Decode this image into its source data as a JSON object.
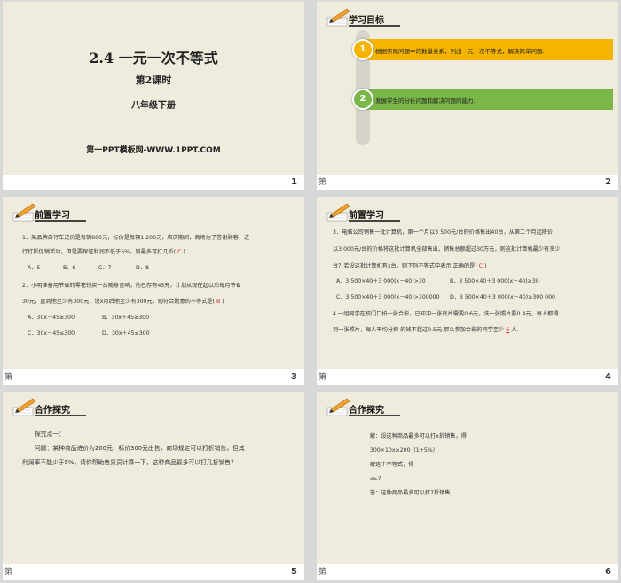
{
  "slide1": {
    "title": "2.4  一元一次不等式",
    "subtitle": "第2课时",
    "grade": "八年级下册",
    "site": "第一PPT模板网-WWW.1PPT.COM",
    "number": "1"
  },
  "slide2": {
    "header": "学习目标",
    "goals": [
      {
        "num": "1",
        "text": "根据实际问题中的数量关系，列出一元一次不等式，解决简单问题.",
        "color": "#f4b400"
      },
      {
        "num": "2",
        "text": "发展学生的分析问题和解决问题的能力.",
        "color": "#7ab648"
      }
    ],
    "number": "2",
    "note": "第"
  },
  "slide3": {
    "header": "前置学习",
    "q1_line1": "1．某品牌自行车进价是每辆800元，标价是每辆1 200元，店庆期间，商场为了答谢顾客，进",
    "q1_line2_a": "行打折促销活动，但是要保证利润不低于5%，则最多可打几折(",
    "q1_answer": "C",
    "q1_line2_b": ")",
    "q1_options": [
      "A．5",
      "B．6",
      "C．7",
      "D．8"
    ],
    "q2_line1": "2．小明准备用节省的零花钱买一台随身音响，他已存有45元，计划从现在起以后每月节省",
    "q2_line2_a": "30元，直到他至少有300元．设x月后他至少有300元，则符合题意的不等式是(",
    "q2_answer": "B",
    "q2_line2_b": ")",
    "q2_options": [
      "A．30x－45≥300",
      "B．30x＋45≥300",
      "C．30x－45≤300",
      "D．30x＋45≤300"
    ],
    "number": "3",
    "note": "第"
  },
  "slide4": {
    "header": "前置学习",
    "q3_line1": "3．电脑公司销售一批计算机，第一个月以3 500元/台的价格售出40台，从第二个月起降价，",
    "q3_line2": "以3 000元/台的价格将这批计算机全部售出，销售总额超过30万元，则这批计算机最少有多少",
    "q3_line3_a": "台？若设这批计算机有x台，则下列不等式中表示  正确的是(",
    "q3_answer": "C",
    "q3_line3_b": ")",
    "q3_options": [
      "A．3 500×40＋3 000(x－40)>30",
      "B．3 500×40＋3 000(x－40)≥30",
      "C．3 500×40＋3 000(x－40)>300000",
      "D．3 500×40＋3 000(x－40)≥300 000"
    ],
    "q4_line1": "4.一组同学在校门口拍一张合影，已知冲一张底片需要0.6元，洗一张照片要0.4元，每人都得",
    "q4_line2_a": "到一张照片，每人平均分担  的钱不超过0.5元.那么参加合影的同学至少",
    "q4_answer": "6",
    "q4_line2_b": "人.",
    "number": "4",
    "note": "第"
  },
  "slide5": {
    "header": "合作探究",
    "line1": "探究点一：",
    "line2": "问题：某种商品进价为200元，标价300元出售，商场规定可以打折销售，但其",
    "line3": "利润率不能少于5%，请你帮助售货员计算一下，这种商品最多可以打几折销售？",
    "number": "5",
    "note": "第"
  },
  "slide6": {
    "header": "合作探究",
    "lines": [
      "解：设这种商品最多可以打x折销售，得",
      "300×10x≥200（1+5%）",
      "解这个不等式，得",
      "x≥7",
      "答：这种商品最多可以打7折销售."
    ],
    "number": "6",
    "note": "第"
  }
}
